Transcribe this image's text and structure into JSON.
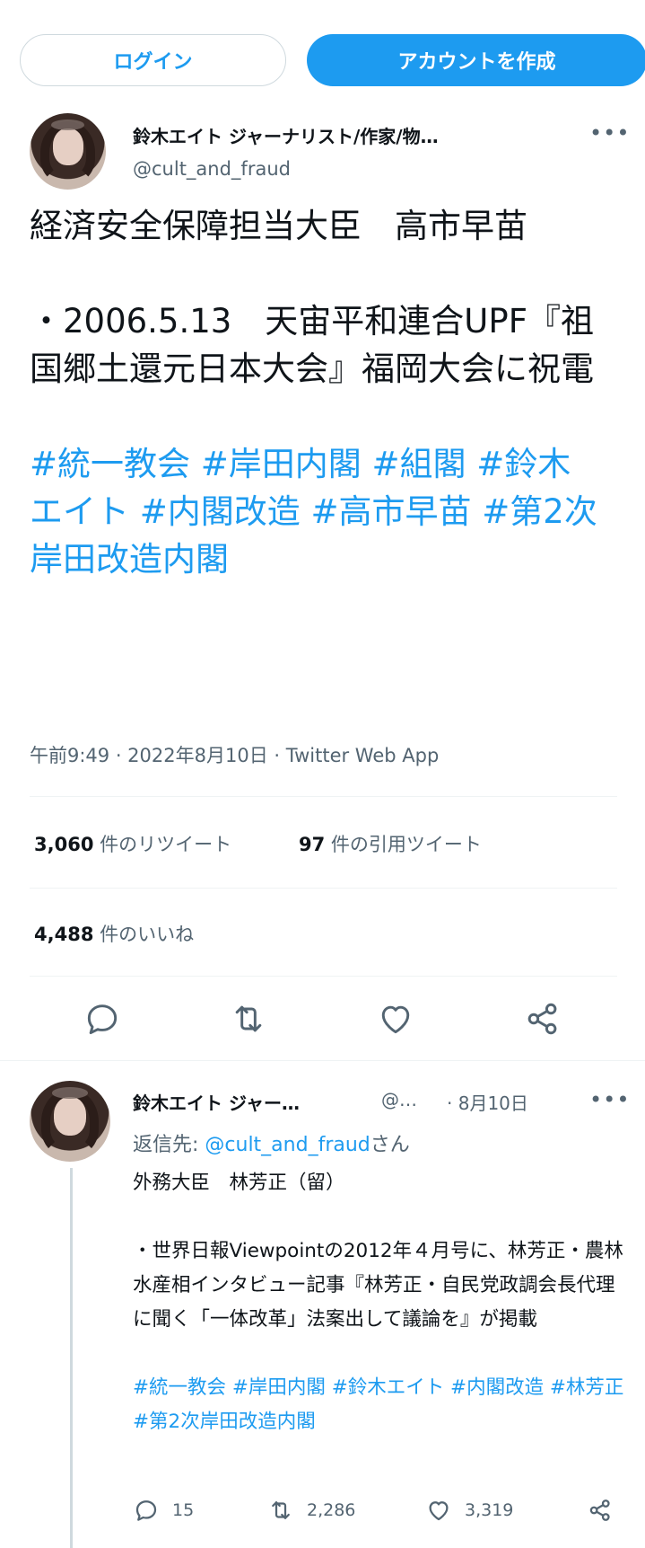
{
  "header": {
    "login_label": "ログイン",
    "signup_label": "アカウントを作成"
  },
  "tweet": {
    "author_name": "鈴木エイト ジャーナリスト/作家/物…",
    "author_handle": "@cult_and_fraud",
    "lines": [
      "経済安全保障担当大臣　高市早苗",
      "",
      "・2006.5.13　天宙平和連合UPF『祖国郷土還元日本大会』福岡大会に祝電",
      ""
    ],
    "hashtags": "#統一教会 #岸田内閣 #組閣 #鈴木エイト #内閣改造 #高市早苗 #第2次岸田改造内閣",
    "meta": "午前9:49 · 2022年8月10日 · Twitter Web App",
    "retweets_count": "3,060",
    "retweets_label": "件のリツイート",
    "quotes_count": "97",
    "quotes_label": "件の引用ツイート",
    "likes_count": "4,488",
    "likes_label": "件のいいね"
  },
  "reply": {
    "author_name": "鈴木エイト ジャー…",
    "author_handle": "@…",
    "date": "· 8月10日",
    "reply_to_prefix": "返信先: ",
    "reply_to_link": "@cult_and_fraud",
    "reply_to_suffix": "さん",
    "line1": "外務大臣　林芳正（留）",
    "line2": "・世界日報Viewpointの2012年４月号に、林芳正・農林水産相インタビュー記事『林芳正・自民党政調会長代理に聞く「一体改革」法案出して議論を』が掲載",
    "hashtags": "#統一教会 #岸田内閣 #鈴木エイト #内閣改造 #林芳正 #第2次岸田改造内閣",
    "reply_count": "15",
    "retweet_count": "2,286",
    "like_count": "3,319"
  },
  "icons": {
    "more": "more-icon",
    "reply": "comment-icon",
    "retweet": "retweet-icon",
    "like": "heart-icon",
    "share": "share-icon"
  },
  "colors": {
    "accent": "#1d9bf0",
    "secondary_text": "#536471",
    "text": "#0f1419",
    "divider": "#eff3f4"
  }
}
